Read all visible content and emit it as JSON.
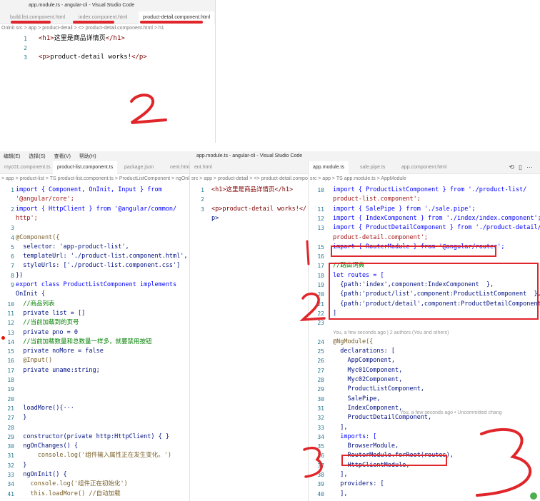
{
  "top_window": {
    "title": "app.module.ts - angular-cli - Visual Studio Code",
    "tabs": [
      "build.list.component.html",
      "index.component.html",
      "product-detail.component.html"
    ],
    "breadcrumb": "Onlnit src > app > product-detail > <> product-detail.component.html > h1",
    "lines": [
      {
        "n": "1",
        "html_open": "<h1>",
        "text": "这里是商品详情页",
        "html_close": "</h1>"
      },
      {
        "n": "2",
        "text": ""
      },
      {
        "n": "3",
        "html_open": "<p>",
        "text": "product-detail works!",
        "html_close": "</p>"
      }
    ],
    "annotation": "2"
  },
  "bottom": {
    "menu": [
      "编辑(E)",
      "选择(S)",
      "查看(V)",
      "帮助(H)"
    ],
    "window_title": "app.module.ts - angular-cli - Visual Studio Code",
    "left_panel": {
      "tabs": [
        "myc01.component.ts",
        "product-list.component.ts",
        "package.json",
        "nent.html"
      ],
      "breadcrumb": "> app > product-list > TS product-list.component.ts > ProductListComponent > ngOnInit",
      "lines": [
        {
          "n": "1",
          "code": "import { Component, OnInit, Input } from"
        },
        {
          "n": "",
          "code": "'@angular/core';"
        },
        {
          "n": "2",
          "code": "import { HttpClient } from '@angular/common/"
        },
        {
          "n": "",
          "code": "http';"
        },
        {
          "n": "3",
          "code": ""
        },
        {
          "n": "4",
          "code": "@Component({"
        },
        {
          "n": "5",
          "code": "  selector: 'app-product-list',"
        },
        {
          "n": "6",
          "code": "  templateUrl: './product-list.component.html',"
        },
        {
          "n": "7",
          "code": "  styleUrls: ['./product-list.component.css']"
        },
        {
          "n": "8",
          "code": "})"
        },
        {
          "n": "9",
          "code": "export class ProductListComponent implements"
        },
        {
          "n": "",
          "code": "OnInit {"
        },
        {
          "n": "10",
          "code": "  //商品列表"
        },
        {
          "n": "11",
          "code": "  private list = []"
        },
        {
          "n": "12",
          "code": "  //当前加载到的页号"
        },
        {
          "n": "13",
          "code": "  private pno = 0"
        },
        {
          "n": "14",
          "code": "  //当前加载数量和总数量一样多，就要禁用按钮"
        },
        {
          "n": "15",
          "code": "  private noMore = false"
        },
        {
          "n": "16",
          "code": "  @Input()"
        },
        {
          "n": "17",
          "code": "  private uname:string;"
        },
        {
          "n": "18",
          "code": ""
        },
        {
          "n": "19",
          "code": ""
        },
        {
          "n": "20",
          "code": ""
        },
        {
          "n": "21",
          "code": "  loadMore(){···"
        },
        {
          "n": "27",
          "code": "  }"
        },
        {
          "n": "28",
          "code": ""
        },
        {
          "n": "29",
          "code": "  constructor(private http:HttpClient) { }"
        },
        {
          "n": "30",
          "code": "  ngOnChanges() {"
        },
        {
          "n": "31",
          "code": "      console.log('组件输入属性正在发生变化。')"
        },
        {
          "n": "32",
          "code": "  }"
        },
        {
          "n": "33",
          "code": "  ngOnInit() {"
        },
        {
          "n": "34",
          "code": "    console.log('组件正在初始化')"
        },
        {
          "n": "41",
          "code": "    this.loadMore() //自动加载"
        }
      ]
    },
    "middle_panel": {
      "tabs": [
        "ent.html"
      ],
      "breadcrumb": "src > app > product-detail > <> product-detail.compon",
      "lines": [
        {
          "n": "1",
          "code": "<h1>这里是商品详情页</h1>"
        },
        {
          "n": "2",
          "code": ""
        },
        {
          "n": "3",
          "code": "<p>product-detail works!</"
        },
        {
          "n": "",
          "code": "p>"
        }
      ]
    },
    "right_panel": {
      "tabs": [
        "app.module.ts",
        "sale.pipe.ts",
        "app.component.html"
      ],
      "breadcrumb": "src > app > TS app.module.ts > AppModule",
      "lines": [
        {
          "n": "10",
          "code": "import { ProductListComponent } from './product-list/"
        },
        {
          "n": "",
          "code": "product-list.component';"
        },
        {
          "n": "11",
          "code": "import { SalePipe } from './sale.pipe';"
        },
        {
          "n": "12",
          "code": "import { IndexComponent } from './index/index.component';"
        },
        {
          "n": "13",
          "code": "import { ProductDetailComponent } from './product-detail/"
        },
        {
          "n": "",
          "code": "product-detail.component';"
        },
        {
          "n": "15",
          "code": "import { RouterModule } from '@angular/router';"
        },
        {
          "n": "16",
          "code": ""
        },
        {
          "n": "17",
          "code": "//路由词典"
        },
        {
          "n": "18",
          "code": "let routes = ["
        },
        {
          "n": "19",
          "code": "  {path:'index',component:IndexComponent  },"
        },
        {
          "n": "20",
          "code": "  {path:'product/list',component:ProductListComponent  },"
        },
        {
          "n": "21",
          "code": "  {path:'product/detail',component:ProductDetailComponent  }"
        },
        {
          "n": "22",
          "code": "]"
        },
        {
          "n": "23",
          "code": ""
        },
        {
          "n": "",
          "code": "You, a few seconds ago | 2 authors (You and others)"
        },
        {
          "n": "24",
          "code": "@NgModule({"
        },
        {
          "n": "25",
          "code": "  declarations: ["
        },
        {
          "n": "26",
          "code": "    AppComponent,"
        },
        {
          "n": "27",
          "code": "    Myc01Component,"
        },
        {
          "n": "28",
          "code": "    Myc02Component,"
        },
        {
          "n": "29",
          "code": "    ProductListComponent,"
        },
        {
          "n": "30",
          "code": "    SalePipe,"
        },
        {
          "n": "31",
          "code": "    IndexComponent,"
        },
        {
          "n": "32",
          "code": "    ProductDetailComponent,"
        },
        {
          "n": "33",
          "code": "  ],"
        },
        {
          "n": "34",
          "code": "  imports: ["
        },
        {
          "n": "35",
          "code": "    BrowserModule,"
        },
        {
          "n": "36",
          "code": "    RouterModule.forRoot(routes),"
        },
        {
          "n": "37",
          "code": "    HttpClientModule,"
        },
        {
          "n": "38",
          "code": "  ],"
        },
        {
          "n": "39",
          "code": "  providers: ["
        },
        {
          "n": "40",
          "code": "  ],"
        }
      ],
      "inline_blame": "You, a few seconds ago • Uncommitted chang"
    },
    "annotations": [
      "1",
      "2",
      "3",
      "3"
    ]
  },
  "colors": {
    "annotation_red": "#e0262a",
    "keyword": "#0000ff",
    "string": "#a31515",
    "comment": "#008000",
    "tag": "#800000",
    "line_number": "#237893"
  }
}
